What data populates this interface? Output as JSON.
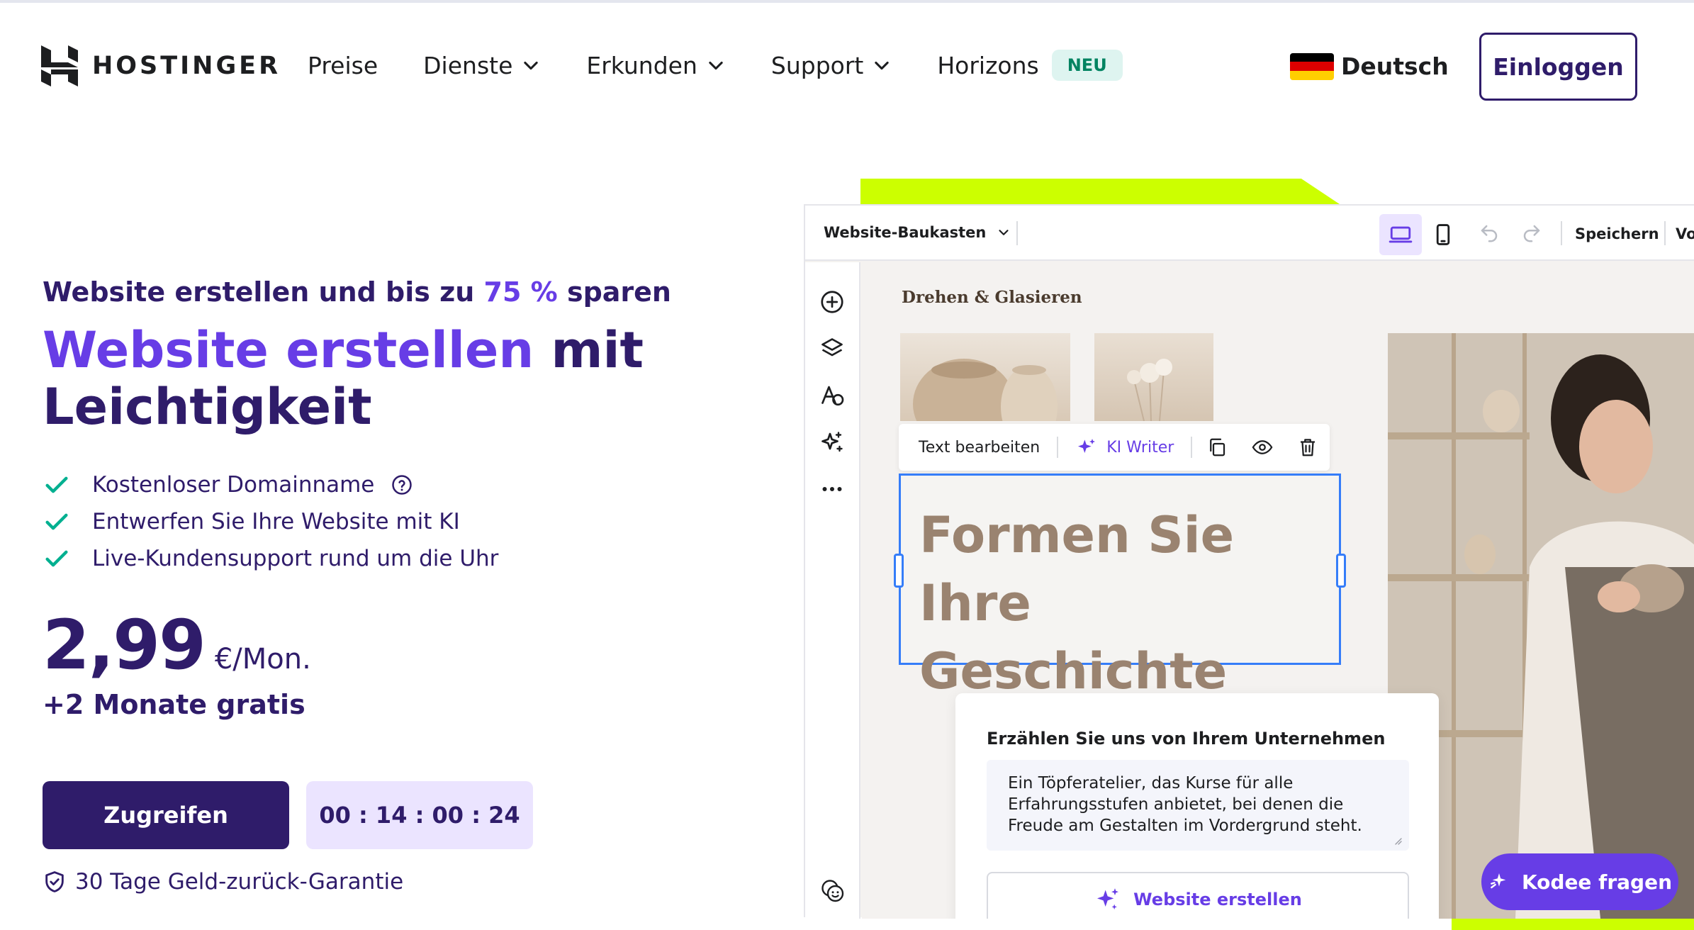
{
  "header": {
    "logo_text": "HOSTINGER",
    "nav": [
      {
        "label": "Preise"
      },
      {
        "label": "Dienste"
      },
      {
        "label": "Erkunden"
      },
      {
        "label": "Support"
      },
      {
        "label": "Horizons",
        "badge": "NEU"
      }
    ],
    "language": "Deutsch",
    "login_label": "Einloggen"
  },
  "hero": {
    "subtitle_pre": "Website erstellen und bis zu ",
    "subtitle_accent": "75 %",
    "subtitle_post": " sparen",
    "headline_accent": "Website erstellen",
    "headline_rest_1": " mit",
    "headline_rest_2": "Leichtigkeit",
    "features": [
      "Kostenloser Domainname",
      "Entwerfen Sie Ihre Website mit KI",
      "Live-Kundensupport rund um die Uhr"
    ],
    "price": "2,99",
    "price_unit": "€/Mon.",
    "bonus": "+2 Monate gratis",
    "cta_label": "Zugreifen",
    "timer": "00 : 14 : 00 : 24",
    "guarantee": "30 Tage Geld-zurück-Garantie"
  },
  "builder": {
    "title": "Website-Baukasten",
    "save_label": "Speichern",
    "preview_label": "Vo",
    "brand": "Drehen & Glasieren",
    "context_bar": {
      "edit_text": "Text bearbeiten",
      "ai_writer": "KI Writer"
    },
    "selected_heading_line1": "Formen Sie Ihre",
    "selected_heading_line2": "Geschichte",
    "about": {
      "title": "Erzählen Sie uns von Ihrem Unternehmen",
      "text": "Ein Töpferatelier, das Kurse für alle Erfahrungsstufen anbietet, bei denen die Freude am Gestalten im Vordergrund steht.",
      "button": "Website erstellen"
    }
  },
  "chat": {
    "label": "Kodee fragen"
  },
  "colors": {
    "brand_dark": "#2f1c6a",
    "brand_accent": "#673de6",
    "lime": "#ccff00",
    "success": "#00b090",
    "selection": "#357df9"
  },
  "icons": [
    "hostinger-logo-icon",
    "chevron-down-icon",
    "germany-flag-icon",
    "check-icon",
    "help-circle-icon",
    "shield-check-icon",
    "desktop-icon",
    "mobile-icon",
    "undo-icon",
    "redo-icon",
    "add-circle-icon",
    "layers-icon",
    "text-style-icon",
    "ai-sparkle-icon",
    "more-icon",
    "emoji-icon",
    "duplicate-icon",
    "eye-icon",
    "trash-icon",
    "kodee-icon"
  ]
}
